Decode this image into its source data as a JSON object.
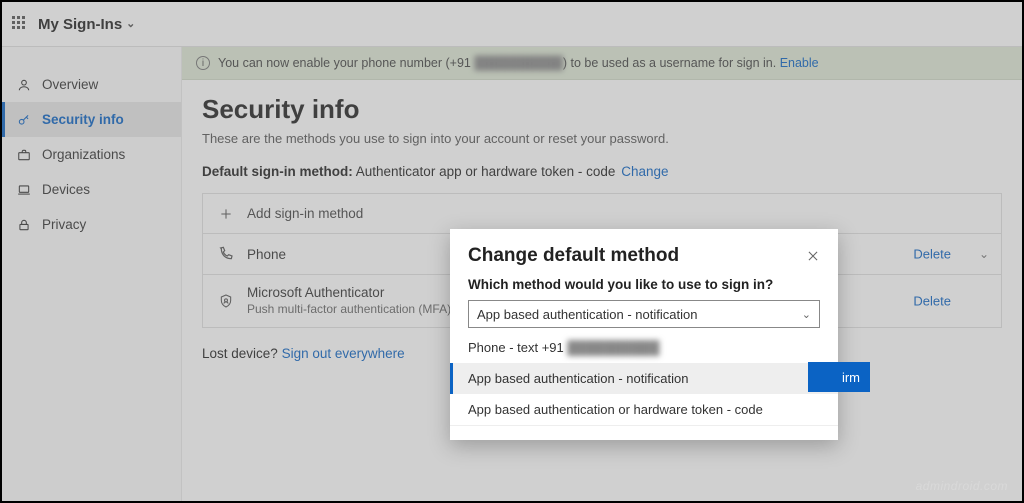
{
  "header": {
    "title": "My Sign-Ins"
  },
  "sidebar": {
    "items": [
      {
        "label": "Overview"
      },
      {
        "label": "Security info"
      },
      {
        "label": "Organizations"
      },
      {
        "label": "Devices"
      },
      {
        "label": "Privacy"
      }
    ]
  },
  "banner": {
    "text_prefix": "You can now enable your phone number (+91 ",
    "text_masked": "██████████",
    "text_suffix": ") to be used as a username for sign in. ",
    "link": "Enable"
  },
  "page": {
    "title": "Security info",
    "subtitle": "These are the methods you use to sign into your account or reset your password.",
    "default_label": "Default sign-in method:",
    "default_value": "Authenticator app or hardware token - code",
    "change_link": "Change",
    "add_method": "Add sign-in method",
    "methods": [
      {
        "title": "Phone",
        "delete": "Delete",
        "expandable": true
      },
      {
        "title": "Microsoft Authenticator",
        "subtitle": "Push multi-factor authentication (MFA)",
        "delete": "Delete",
        "expandable": false
      }
    ],
    "lost_prefix": "Lost device? ",
    "lost_link": "Sign out everywhere"
  },
  "modal": {
    "title": "Change default method",
    "question": "Which method would you like to use to sign in?",
    "selected": "App based authentication - notification",
    "options": [
      {
        "label_prefix": "Phone - text +91 ",
        "label_masked": "██████████"
      },
      {
        "label": "App based authentication - notification",
        "selected": true
      },
      {
        "label": "App based authentication or hardware token - code"
      }
    ],
    "confirm_fragment": "irm"
  },
  "watermark": "admindroid.com"
}
